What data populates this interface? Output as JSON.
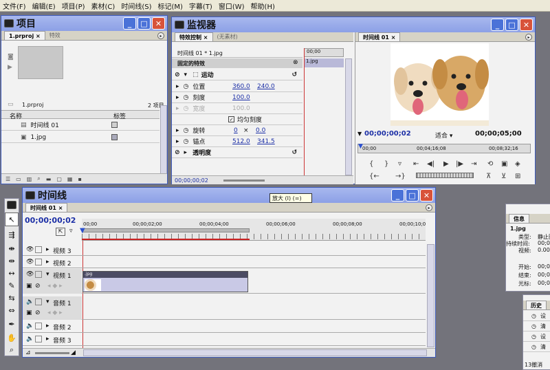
{
  "menu": [
    "文件(F)",
    "编辑(E)",
    "项目(P)",
    "素材(C)",
    "时间线(S)",
    "标记(M)",
    "字幕(T)",
    "窗口(W)",
    "帮助(H)"
  ],
  "project": {
    "title": "项目",
    "tabs": [
      "1.prproj",
      "特效"
    ],
    "file_name": "1.prproj",
    "item_count": "2 项目",
    "col_name": "名称",
    "col_label": "标签",
    "items": [
      "时间线 01",
      "1.jpg"
    ]
  },
  "monitor": {
    "title": "监视器",
    "tabs": [
      "特效控制",
      "(无素材)"
    ],
    "fx_header": "时间线 01 * 1.jpg",
    "ruler_time": "00;00",
    "clip_label": "1.jpg",
    "fixed_fx": "固定的特效",
    "motion": "运动",
    "position": {
      "label": "位置",
      "x": "360.0",
      "y": "240.0"
    },
    "scale": {
      "label": "刻度",
      "value": "100.0"
    },
    "width": {
      "label": "宽度",
      "value": "100.0"
    },
    "uniform": "均匀刻度",
    "rotation": {
      "label": "旋转",
      "a": "0",
      "x": "×",
      "b": "0.0"
    },
    "anchor": {
      "label": "锚点",
      "x": "512.0",
      "y": "341.5"
    },
    "opacity": "透明度",
    "footer_time": "00;00;00;02"
  },
  "program": {
    "tab": "时间线 01",
    "current_time": "00;00;00;02",
    "fit": "适合",
    "duration": "00;00;05;00",
    "ruler": [
      "00;00",
      "00;04;16;08",
      "00;08;32;16"
    ]
  },
  "timeline": {
    "title": "时间线",
    "tab": "时间线 01",
    "current_time": "00;00;00;02",
    "tooltip": "放大 (I)   (=)",
    "ruler": [
      "00;00",
      "00;00;02;00",
      "00;00;04;00",
      "00;00;06;00",
      "00;00;08;00",
      "00;00;10;0"
    ],
    "video_tracks": [
      "视频 3",
      "视频 2",
      "视频 1"
    ],
    "audio_tracks": [
      "音频 1",
      "音频 2",
      "音频 3"
    ],
    "clip": ".jpg"
  },
  "info": {
    "title": "信息",
    "file": "1.jpg",
    "rows": [
      [
        "类型:",
        "静止图"
      ],
      [
        "持续时间:",
        "00;00;"
      ],
      [
        "视频:",
        "0.00 fp"
      ]
    ],
    "rows2": [
      [
        "开始:",
        "00;00"
      ],
      [
        "结束:",
        "00;00"
      ],
      [
        "光标:",
        "00;00"
      ]
    ]
  },
  "history": {
    "title": "历史",
    "items": [
      "设",
      "清",
      "设",
      "清"
    ],
    "footer": "13撤消"
  }
}
